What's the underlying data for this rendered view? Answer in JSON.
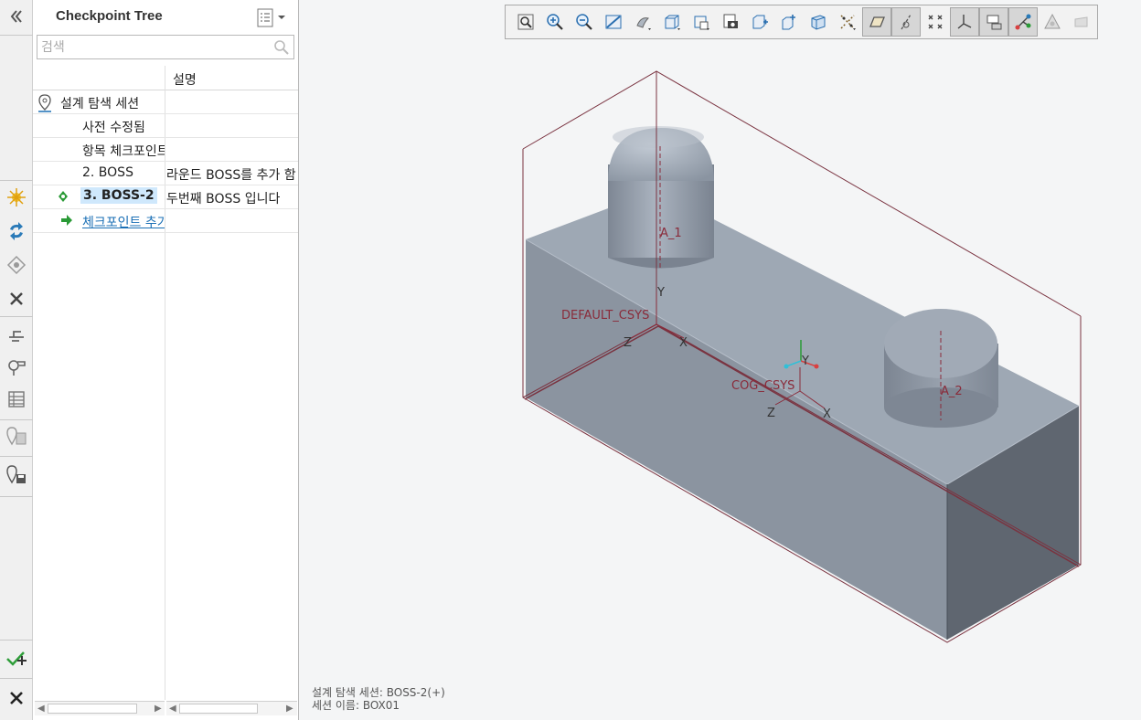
{
  "panel": {
    "title": "Checkpoint Tree",
    "search_placeholder": "검색",
    "col_desc": "설명"
  },
  "tree": {
    "rows": [
      {
        "name": "설계 탐색 세션",
        "desc": ""
      },
      {
        "name": "사전 수정됨",
        "desc": ""
      },
      {
        "name": "항목 체크포인트",
        "desc": ""
      },
      {
        "name": "2. BOSS",
        "desc": "라운드 BOSS를 추가 함"
      },
      {
        "name": "3. BOSS-2",
        "desc": "두번째 BOSS 입니다"
      },
      {
        "name": "체크포인트 추가",
        "desc": ""
      }
    ]
  },
  "model": {
    "labels": {
      "a1": "A_1",
      "a2": "A_2",
      "default_csys": "DEFAULT_CSYS",
      "cog_csys": "COG_CSYS",
      "y1": "Y",
      "x1": "X",
      "z1": "Z",
      "y2": "Y",
      "x2": "X",
      "z2": "Z"
    }
  },
  "status": {
    "line1": "설계 탐색 세션: BOSS-2(+)",
    "line2": "세션 이름: BOX01"
  },
  "colors": {
    "accent_blue": "#1a6fb5",
    "selection": "#cfe8fc",
    "model_gray": "#97a2b0",
    "bbox_line": "#7a3340"
  },
  "icons": {
    "left_toolbar": [
      "collapse-icon",
      "explore-icon",
      "refresh-icon",
      "checkpoint-icon",
      "close-icon",
      "branch-icon",
      "settings-icon",
      "table-icon",
      "export-icon",
      "save-session-icon",
      "accept-icon",
      "cancel-icon"
    ],
    "top_toolbar": [
      "refit-icon",
      "zoom-in-icon",
      "zoom-out-icon",
      "repaint-icon",
      "view-manager-icon",
      "saved-orientations-icon",
      "display-style-icon",
      "screenshot-icon",
      "named-views-icon",
      "spin-center-icon",
      "perspective-icon",
      "datum-display-icon",
      "plane-display-icon",
      "axis-display-icon",
      "point-display-icon",
      "csys-display-icon",
      "annotation-display-icon",
      "model-tree-icon",
      "simulation-icon",
      "render-icon"
    ]
  }
}
